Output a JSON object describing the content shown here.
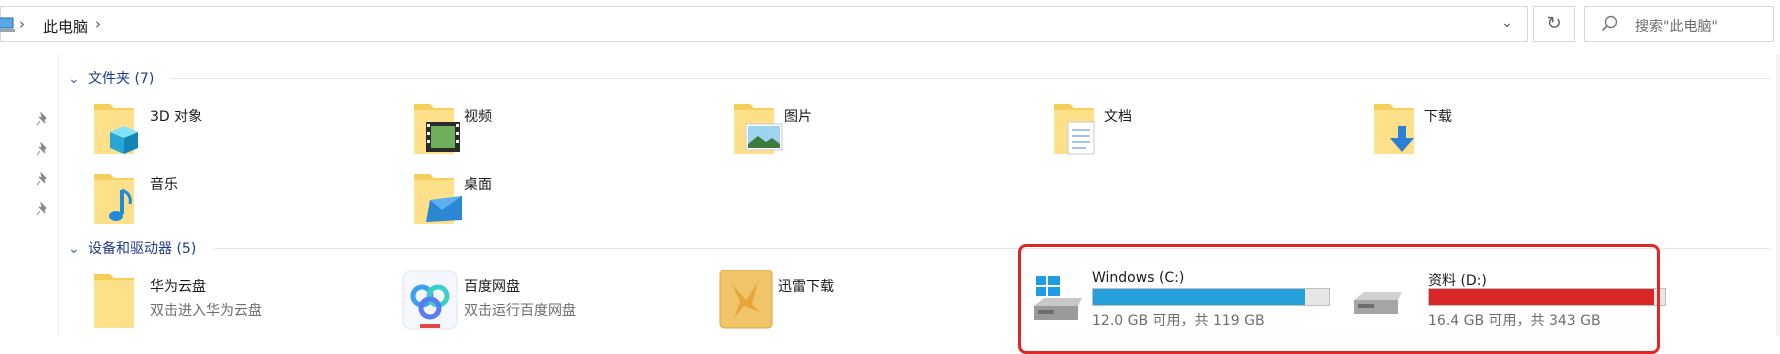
{
  "address": {
    "location": "此电脑"
  },
  "search": {
    "placeholder": "搜索\"此电脑\""
  },
  "groups": {
    "folders": {
      "title": "文件夹 (7)",
      "items": [
        {
          "label": "3D 对象",
          "icon": "3d-objects-folder-icon"
        },
        {
          "label": "视频",
          "icon": "videos-folder-icon"
        },
        {
          "label": "图片",
          "icon": "pictures-folder-icon"
        },
        {
          "label": "文档",
          "icon": "documents-folder-icon"
        },
        {
          "label": "下载",
          "icon": "downloads-folder-icon"
        },
        {
          "label": "音乐",
          "icon": "music-folder-icon"
        },
        {
          "label": "桌面",
          "icon": "desktop-folder-icon"
        }
      ]
    },
    "devices": {
      "title": "设备和驱动器 (5)",
      "items": [
        {
          "label": "华为云盘",
          "sub": "双击进入华为云盘",
          "icon": "huawei-cloud-drive-icon"
        },
        {
          "label": "百度网盘",
          "sub": "双击运行百度网盘",
          "icon": "baidu-netdisk-icon"
        },
        {
          "label": "迅雷下载",
          "icon": "xunlei-download-icon"
        },
        {
          "label": "Windows (C:)",
          "sub": "12.0 GB 可用，共 119 GB",
          "icon": "windows-drive-icon",
          "used_fraction": 0.9
        },
        {
          "label": "资料 (D:)",
          "sub": "16.4 GB 可用，共 343 GB",
          "icon": "hard-drive-icon",
          "used_fraction": 0.952
        }
      ]
    }
  },
  "colors": {
    "drive_normal": "#26a0da",
    "drive_full": "#da2626",
    "highlight": "#e02727"
  }
}
